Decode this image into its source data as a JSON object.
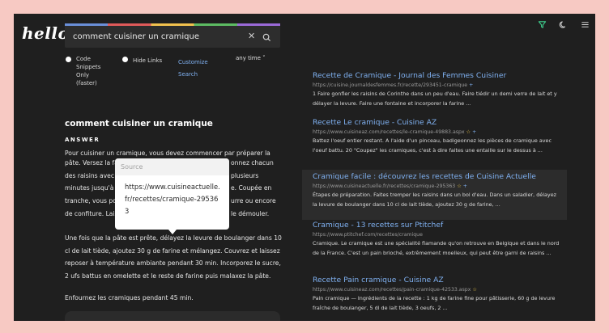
{
  "logo": "hello",
  "search": {
    "query": "comment cuisiner un cramique",
    "clear_glyph": "✕"
  },
  "options": {
    "code_snippets": [
      "Code",
      "Snippets",
      "Only",
      "(faster)"
    ],
    "hide_links": "Hide Links",
    "customize": [
      "Customize",
      "Search"
    ],
    "time_filter": "any time ˅"
  },
  "header_icons": [
    "filter-icon",
    "moon-icon",
    "menu-icon"
  ],
  "answer": {
    "title": "comment cuisiner un cramique",
    "label": "ANSWER",
    "p1_line1": "Pour cuisiner un cramique, vous devez commencer par préparer la",
    "p1_frags": [
      "pâte. Versez la fa",
      "onnez chacun",
      "des raisins avec",
      "plusieurs",
      "minutes jusqu'à c",
      "e. Coupée en",
      "tranche, vous po",
      "urre ou encore",
      "de confiture. Lais",
      "le démouler."
    ],
    "p2": "Une fois que la pâte est prête, délayez la levure de boulanger dans 10 cl de lait tiède, ajoutez 30 g de farine et mélangez. Couvrez et laissez reposer à température ambiante pendant 30 min. Incorporez le sucre, 2 ufs battus en omelette et le reste de farine puis malaxez la pâte.",
    "p3": "Enfournez les cramiques pendant 45 min."
  },
  "popup": {
    "header": "Source",
    "url": "https://www.cuisineactuelle.fr/recettes/cramique-295363"
  },
  "results": [
    {
      "title": "Recette de Cramique - Journal des Femmes Cuisiner",
      "url": "https://cuisine.journaldesfemmes.fr/recette/293451-cramique",
      "star": "",
      "plus": "+",
      "snippet": "1 Faire gonfler les raisins de Corinthe dans un peu d'eau. Faire tiédir un demi verre de lait et y délayer la levure. Faire une fontaine et incorporer la farine ..."
    },
    {
      "title": "Recette Le cramique - Cuisine AZ",
      "url": "https://www.cuisineaz.com/recettes/le-cramique-49883.aspx",
      "star": "☆",
      "plus": "+",
      "snippet": "Battez l'oeuf entier restant. A l'aide d'un pinceau, badigeonnez les pièces de cramique avec l'oeuf battu. 20 \"Coupez\" les cramiques, c'est à dire faites une entaille sur le dessus à ..."
    },
    {
      "title": "Cramique facile : découvrez les recettes de Cuisine Actuelle",
      "url": "https://www.cuisineactuelle.fr/recettes/cramique-295363",
      "star": "☆",
      "plus": "+",
      "snippet": "Étapes de préparation. Faites tremper les raisins dans un bol d'eau. Dans un saladier, délayez la levure de boulanger dans 10 cl de lait tiède, ajoutez 30 g de farine, ..."
    },
    {
      "title": "Cramique - 13 recettes sur Ptitchef",
      "url": "https://www.ptitchef.com/recettes/cramique",
      "star": "",
      "plus": "",
      "snippet": "Cramique. Le cramique est une spécialité flamande qu'on retrouve en Belgique et dans le nord de la France. C'est un pain brioché, extrêmement moelleux, qui peut être garni de raisins ..."
    },
    {
      "title": "Recette Pain cramique - Cuisine AZ",
      "url": "https://www.cuisineaz.com/recettes/pain-cramique-42533.aspx",
      "star": "☆",
      "plus": "",
      "snippet": "Pain cramique — Ingrédients de la recette : 1 kg de farine fine pour pâtisserie, 60 g de levure fraîche de boulanger, 5 dl de lait tiède, 3 oeufs, 2 ..."
    }
  ],
  "colors": {
    "link": "#7fb0f0",
    "background": "#1f1f1f",
    "filter_icon": "#3ecf8e"
  }
}
